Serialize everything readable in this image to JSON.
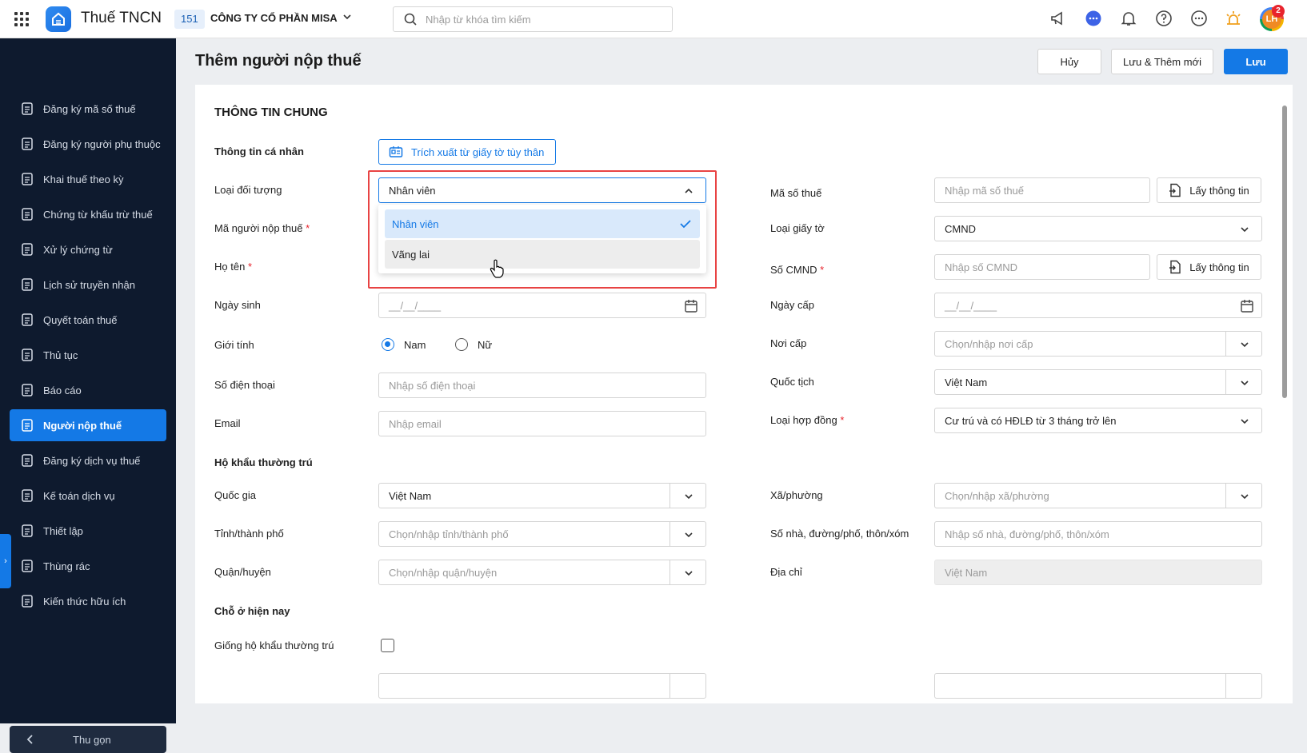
{
  "topbar": {
    "app_title": "Thuế TNCN",
    "company_code": "151",
    "company_name": "CÔNG TY CỔ PHẦN MISA",
    "search_placeholder": "Nhập từ khóa tìm kiếm",
    "avatar_initials": "LH",
    "notification_count": "2",
    "icons": [
      "megaphone-icon",
      "chat-icon",
      "bell-icon",
      "help-icon",
      "more-icon",
      "lightbulb-icon"
    ]
  },
  "sidebar": {
    "items": [
      {
        "label": "Đăng ký mã số thuế",
        "icon": "id-scan-icon"
      },
      {
        "label": "Đăng ký người phụ thuộc",
        "icon": "dependents-icon"
      },
      {
        "label": "Khai thuế theo kỳ",
        "icon": "document-icon"
      },
      {
        "label": "Chứng từ khấu trừ thuế",
        "icon": "voucher-icon"
      },
      {
        "label": "Xử lý chứng từ",
        "icon": "document-check-icon"
      },
      {
        "label": "Lịch sử truyền nhận",
        "icon": "transfer-icon"
      },
      {
        "label": "Quyết toán thuế",
        "icon": "settlement-icon"
      },
      {
        "label": "Thủ tục",
        "icon": "procedure-icon"
      },
      {
        "label": "Báo cáo",
        "icon": "pie-chart-icon"
      },
      {
        "label": "Người nộp thuế",
        "icon": "taxpayer-icon",
        "active": true
      },
      {
        "label": "Đăng ký dịch vụ thuế",
        "icon": "service-register-icon"
      },
      {
        "label": "Kế toán dịch vụ",
        "icon": "accounting-icon"
      },
      {
        "label": "Thiết lập",
        "icon": "gear-icon"
      },
      {
        "label": "Thùng rác",
        "icon": "trash-icon"
      },
      {
        "label": "Kiến thức hữu ích",
        "icon": "knowledge-icon"
      }
    ],
    "collapse_label": "Thu gọn"
  },
  "header": {
    "page_title": "Thêm người nộp thuế",
    "cancel_label": "Hủy",
    "save_new_label": "Lưu & Thêm mới",
    "save_label": "Lưu"
  },
  "form": {
    "section_title": "THÔNG TIN CHUNG",
    "personal_info_label": "Thông tin cá nhân",
    "extract_button": "Trích xuất từ giấy tờ tùy thân",
    "object_type_label": "Loại đối tượng",
    "object_type_value": "Nhân viên",
    "object_type_options": [
      "Nhân viên",
      "Vãng lai"
    ],
    "taxpayer_code_label": "Mã người nộp thuế",
    "full_name_label": "Họ tên",
    "dob_label": "Ngày sinh",
    "dob_placeholder": "__/__/____",
    "gender_label": "Giới tính",
    "gender_male": "Nam",
    "gender_female": "Nữ",
    "phone_label": "Số điện thoại",
    "phone_placeholder": "Nhập số điện thoại",
    "email_label": "Email",
    "email_placeholder": "Nhập email",
    "tax_code_label": "Mã số thuế",
    "tax_code_placeholder": "Nhập mã số thuế",
    "get_info_label": "Lấy thông tin",
    "doc_type_label": "Loại giấy tờ",
    "doc_type_value": "CMND",
    "id_number_label": "Số CMND",
    "id_number_placeholder": "Nhập số CMND",
    "issue_date_label": "Ngày cấp",
    "issue_date_placeholder": "__/__/____",
    "issue_place_label": "Nơi cấp",
    "issue_place_placeholder": "Chọn/nhập nơi cấp",
    "nationality_label": "Quốc tịch",
    "nationality_value": "Việt Nam",
    "contract_type_label": "Loại hợp đồng",
    "contract_type_value": "Cư trú và có HĐLĐ từ 3 tháng trở lên",
    "permanent_address_title": "Hộ khẩu thường trú",
    "country_label": "Quốc gia",
    "country_value": "Việt Nam",
    "province_label": "Tỉnh/thành phố",
    "province_placeholder": "Chọn/nhập tỉnh/thành phố",
    "district_label": "Quận/huyện",
    "district_placeholder": "Chọn/nhập quận/huyện",
    "ward_label": "Xã/phường",
    "ward_placeholder": "Chọn/nhập xã/phường",
    "street_label": "Số nhà, đường/phố, thôn/xóm",
    "street_placeholder": "Nhập số nhà, đường/phố, thôn/xóm",
    "address_label": "Địa chỉ",
    "address_value": "Việt Nam",
    "current_residence_title": "Chỗ ở hiện nay",
    "same_as_permanent_label": "Giống hộ khẩu thường trú"
  },
  "colors": {
    "primary": "#1479e6",
    "sidebar_bg": "#0e1a2e",
    "highlight": "#e84343",
    "required": "#e8242d"
  }
}
